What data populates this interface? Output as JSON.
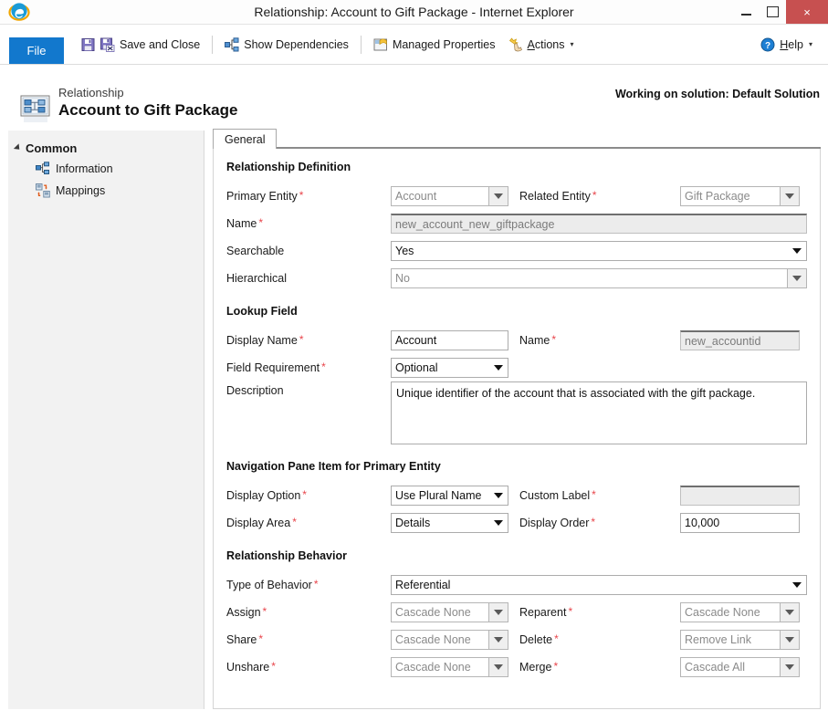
{
  "window": {
    "title": "Relationship: Account to Gift Package - Internet Explorer",
    "app_icon": "internet-explorer-icon",
    "minimize": "–",
    "maximize": "□",
    "close": "×",
    "close_color": "#c75050"
  },
  "ribbon": {
    "file_label": "File",
    "file_tab_color": "#1278cd",
    "items": [
      {
        "label": "Save and Close",
        "icon": "save-and-close-icon",
        "has_caret": false
      },
      {
        "label": "Show Dependencies",
        "icon": "show-dependencies-icon",
        "has_caret": false
      },
      {
        "label": "Managed Properties",
        "icon": "managed-properties-icon",
        "has_caret": false
      },
      {
        "label": "Actions",
        "icon": "actions-icon",
        "has_caret": true
      }
    ],
    "help_label": "Help",
    "help_icon": "help-icon",
    "help_caret": "▾"
  },
  "header": {
    "entity_type": "Relationship",
    "title": "Account to Gift Package",
    "icon": "relationship-icon",
    "solution_note": "Working on solution: Default Solution"
  },
  "sidebar": {
    "group_label": "Common",
    "items": [
      {
        "label": "Information",
        "icon": "information-icon"
      },
      {
        "label": "Mappings",
        "icon": "mappings-icon"
      }
    ]
  },
  "tabs": [
    {
      "label": "General",
      "selected": true
    }
  ],
  "form": {
    "sections": [
      {
        "title": "Relationship Definition",
        "rows": [
          {
            "left": {
              "label": "Primary Entity",
              "required": true,
              "control": "select",
              "value": "Account",
              "disabled": true,
              "width": "sm"
            },
            "right": {
              "label": "Related Entity",
              "required": true,
              "control": "select",
              "value": "Gift Package",
              "disabled": true,
              "width": "right"
            }
          },
          {
            "left": {
              "label": "Name",
              "required": true,
              "control": "input",
              "value": "new_account_new_giftpackage",
              "disabled": true,
              "width": "wide"
            },
            "right": null
          },
          {
            "left": {
              "label": "Searchable",
              "required": false,
              "control": "select",
              "value": "Yes",
              "disabled": false,
              "width": "wide"
            },
            "right": null
          },
          {
            "left": {
              "label": "Hierarchical",
              "required": false,
              "control": "select",
              "value": "No",
              "disabled": true,
              "width": "wide"
            },
            "right": null
          }
        ]
      },
      {
        "title": "Lookup Field",
        "rows": [
          {
            "left": {
              "label": "Display Name",
              "required": true,
              "control": "input",
              "value": "Account",
              "disabled": false,
              "width": "sm"
            },
            "right": {
              "label": "Name",
              "required": true,
              "control": "input",
              "value": "new_accountid",
              "disabled": true,
              "width": "right"
            }
          },
          {
            "left": {
              "label": "Field Requirement",
              "required": true,
              "control": "select",
              "value": "Optional",
              "disabled": false,
              "width": "sm"
            },
            "right": null
          },
          {
            "left": {
              "label": "Description",
              "required": false,
              "control": "textarea",
              "value": "Unique identifier of the account that is associated with the gift package.",
              "disabled": false,
              "width": "wide"
            },
            "right": null
          }
        ]
      },
      {
        "title": "Navigation Pane Item for Primary Entity",
        "rows": [
          {
            "left": {
              "label": "Display Option",
              "required": true,
              "control": "select",
              "value": "Use Plural Name",
              "disabled": false,
              "width": "sm"
            },
            "right": {
              "label": "Custom Label",
              "required": true,
              "control": "input",
              "value": "",
              "disabled": true,
              "width": "right"
            }
          },
          {
            "left": {
              "label": "Display Area",
              "required": true,
              "control": "select",
              "value": "Details",
              "disabled": false,
              "width": "sm"
            },
            "right": {
              "label": "Display Order",
              "required": true,
              "control": "input",
              "value": "10,000",
              "disabled": false,
              "width": "right"
            }
          }
        ]
      },
      {
        "title": "Relationship Behavior",
        "rows": [
          {
            "left": {
              "label": "Type of Behavior",
              "required": true,
              "control": "select",
              "value": "Referential",
              "disabled": false,
              "width": "wide"
            },
            "right": null
          },
          {
            "left": {
              "label": "Assign",
              "required": true,
              "control": "select",
              "value": "Cascade None",
              "disabled": true,
              "width": "sm"
            },
            "right": {
              "label": "Reparent",
              "required": true,
              "control": "select",
              "value": "Cascade None",
              "disabled": true,
              "width": "right"
            }
          },
          {
            "left": {
              "label": "Share",
              "required": true,
              "control": "select",
              "value": "Cascade None",
              "disabled": true,
              "width": "sm"
            },
            "right": {
              "label": "Delete",
              "required": true,
              "control": "select",
              "value": "Remove Link",
              "disabled": true,
              "width": "right"
            }
          },
          {
            "left": {
              "label": "Unshare",
              "required": true,
              "control": "select",
              "value": "Cascade None",
              "disabled": true,
              "width": "sm"
            },
            "right": {
              "label": "Merge",
              "required": true,
              "control": "select",
              "value": "Cascade All",
              "disabled": true,
              "width": "right"
            }
          }
        ]
      }
    ]
  }
}
